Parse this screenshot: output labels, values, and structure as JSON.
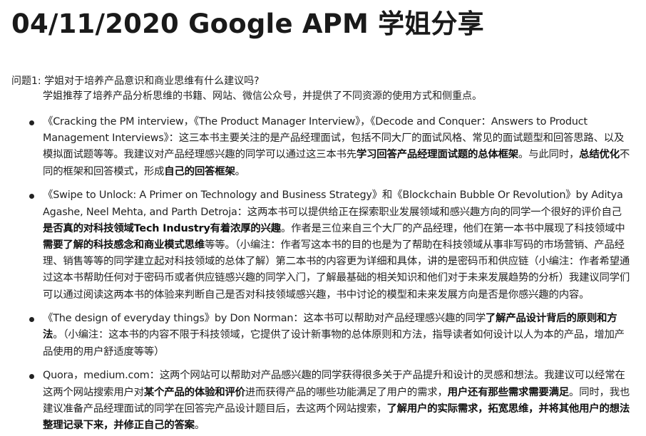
{
  "page": {
    "title": "04/11/2020 Google APM 学姐分享"
  },
  "qa": {
    "question": "问题1: 学姐对于培养产品意识和商业思维有什么建议吗?",
    "answer": "学姐推荐了培养产品分析思维的书籍、网站、微信公众号，并提供了不同资源的使用方式和侧重点。"
  },
  "items": [
    {
      "segments": [
        {
          "text": "《Cracking the PM interview，《The Product Manager Interview》，《Decode and Conquer：Answers to Product Management Interviews》：这三本书主要关注的是产品经理面试，包括不同大厂的面试风格、常见的面试题型和回答思路、以及模拟面试题等等。我建议对产品经理感兴趣的同学可以通过这三本书先",
          "bold": false
        },
        {
          "text": "学习回答产品经理面试题的总体框架",
          "bold": true
        },
        {
          "text": "。与此同时，",
          "bold": false
        },
        {
          "text": "总结优化",
          "bold": true
        },
        {
          "text": "不同的框架和回答模式，形成",
          "bold": false
        },
        {
          "text": "自己的回答框架",
          "bold": true
        },
        {
          "text": "。",
          "bold": false
        }
      ]
    },
    {
      "segments": [
        {
          "text": "《Swipe to Unlock: A Primer on Technology and Business Strategy》和《Blockchain Bubble Or Revolution》by Aditya Agashe, Neel Mehta, and Parth Detroja：这两本书可以提供给正在探索职业发展领域和感兴趣方向的同学一个很好的评价自己",
          "bold": false
        },
        {
          "text": "是否真的对科技领域Tech Industry有着浓厚的兴趣",
          "bold": true
        },
        {
          "text": "。作者是三位来自三个大厂的产品经理，他们在第一本书中展现了科技领域中",
          "bold": false
        },
        {
          "text": "需要了解的科技感念和商业模式思维",
          "bold": true
        },
        {
          "text": "等等。（小编注：作者写这本书的目的也是为了帮助在科技领域从事非写码的市场营销、产品经理、销售等等的同学建立起对科技领域的总体了解）第二本书的内容更为详细和具体，讲的是密码币和供应链（小编注：作者希望通过这本书帮助任何对于密码币或者供应链感兴趣的同学入门，了解最基础的相关知识和他们对于未来发展趋势的分析）我建议同学们可以通过阅读这两本书的体验来判断自己是否对科技领域感兴趣，书中讨论的模型和未来发展方向是否是你感兴趣的内容。",
          "bold": false
        }
      ]
    },
    {
      "segments": [
        {
          "text": "《The design of everyday things》by Don Norman：这本书可以帮助对产品经理感兴趣的同学",
          "bold": false
        },
        {
          "text": "了解产品设计背后的原则和方法",
          "bold": true
        },
        {
          "text": "。（小编注：这本书的内容不限于科技领域，它提供了设计新事物的总体原则和方法，指导读者如何设计以人为本的产品，增加产品使用的用户舒适度等等）",
          "bold": false
        }
      ]
    },
    {
      "segments": [
        {
          "text": "Quora，medium.com：这两个网站可以帮助对产品感兴趣的同学获得很多关于产品提升和设计的灵感和想法。我建议可以经常在这两个网站搜索用户对",
          "bold": false
        },
        {
          "text": "某个产品的体验和评价",
          "bold": true
        },
        {
          "text": "进而获得产品的哪些功能满足了用户的需求，",
          "bold": false
        },
        {
          "text": "用户还有那些需求需要满足",
          "bold": true
        },
        {
          "text": "。同时，我也建议准备产品经理面试的同学在回答完产品设计题目后，去这两个网站搜索，",
          "bold": false
        },
        {
          "text": "了解用户的实际需求，拓宽思维，并将其他用户的想法整理记录下来，并修正自己的答案",
          "bold": true
        },
        {
          "text": "。",
          "bold": false
        }
      ]
    }
  ]
}
